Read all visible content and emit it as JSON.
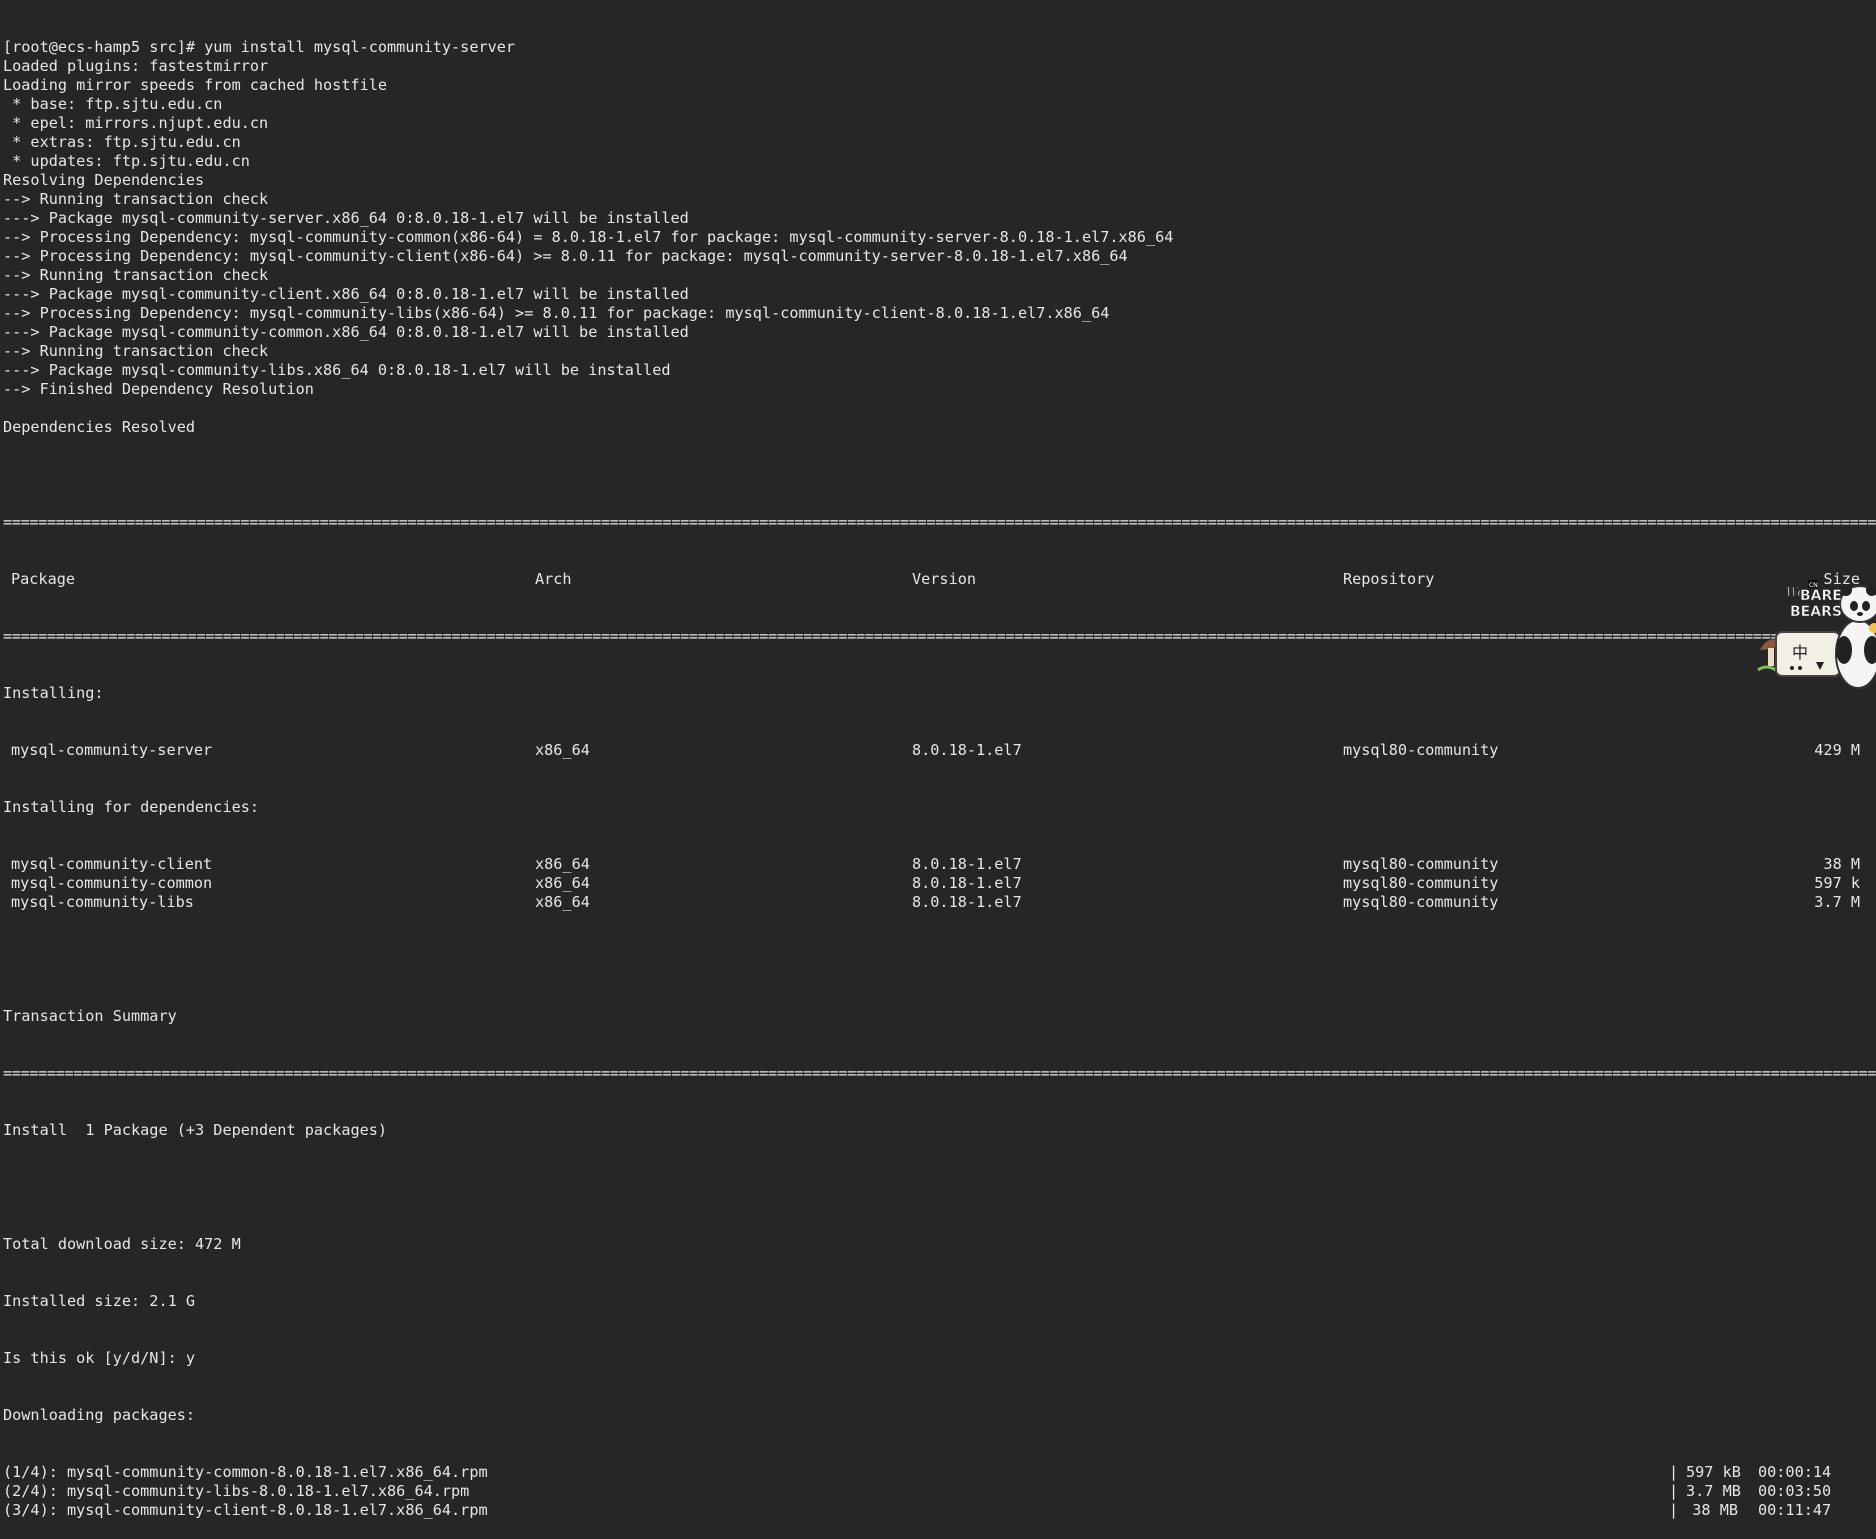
{
  "header_lines": [
    "[root@ecs-hamp5 src]# yum install mysql-community-server",
    "Loaded plugins: fastestmirror",
    "Loading mirror speeds from cached hostfile",
    " * base: ftp.sjtu.edu.cn",
    " * epel: mirrors.njupt.edu.cn",
    " * extras: ftp.sjtu.edu.cn",
    " * updates: ftp.sjtu.edu.cn",
    "Resolving Dependencies",
    "--> Running transaction check",
    "---> Package mysql-community-server.x86_64 0:8.0.18-1.el7 will be installed",
    "--> Processing Dependency: mysql-community-common(x86-64) = 8.0.18-1.el7 for package: mysql-community-server-8.0.18-1.el7.x86_64",
    "--> Processing Dependency: mysql-community-client(x86-64) >= 8.0.11 for package: mysql-community-server-8.0.18-1.el7.x86_64",
    "--> Running transaction check",
    "---> Package mysql-community-client.x86_64 0:8.0.18-1.el7 will be installed",
    "--> Processing Dependency: mysql-community-libs(x86-64) >= 8.0.11 for package: mysql-community-client-8.0.18-1.el7.x86_64",
    "---> Package mysql-community-common.x86_64 0:8.0.18-1.el7 will be installed",
    "--> Running transaction check",
    "---> Package mysql-community-libs.x86_64 0:8.0.18-1.el7 will be installed",
    "--> Finished Dependency Resolution",
    "",
    "Dependencies Resolved",
    ""
  ],
  "table": {
    "separator": "================================================================================================================================================================================================================================================================",
    "columns": {
      "package": "Package",
      "arch": "Arch",
      "version": "Version",
      "repository": "Repository",
      "size": "Size"
    },
    "installing_label": "Installing:",
    "installing_rows": [
      {
        "package": "mysql-community-server",
        "arch": "x86_64",
        "version": "8.0.18-1.el7",
        "repository": "mysql80-community",
        "size": "429 M"
      }
    ],
    "deps_label": "Installing for dependencies:",
    "dep_rows": [
      {
        "package": "mysql-community-client",
        "arch": "x86_64",
        "version": "8.0.18-1.el7",
        "repository": "mysql80-community",
        "size": "38 M"
      },
      {
        "package": "mysql-community-common",
        "arch": "x86_64",
        "version": "8.0.18-1.el7",
        "repository": "mysql80-community",
        "size": "597 k"
      },
      {
        "package": "mysql-community-libs",
        "arch": "x86_64",
        "version": "8.0.18-1.el7",
        "repository": "mysql80-community",
        "size": "3.7 M"
      }
    ]
  },
  "summary": {
    "title": "Transaction Summary",
    "install_line": "Install  1 Package (+3 Dependent packages)",
    "download_size": "Total download size: 472 M",
    "installed_size": "Installed size: 2.1 G",
    "prompt": "Is this ok [y/d/N]: y",
    "downloading": "Downloading packages:"
  },
  "downloads": [
    {
      "name": "(1/4): mysql-community-common-8.0.18-1.el7.x86_64.rpm",
      "size": "597 kB",
      "time": "00:00:14"
    },
    {
      "name": "(2/4): mysql-community-libs-8.0.18-1.el7.x86_64.rpm",
      "size": "3.7 MB",
      "time": "00:03:50"
    },
    {
      "name": "(3/4): mysql-community-client-8.0.18-1.el7.x86_64.rpm",
      "size": "38 MB",
      "time": "00:11:47"
    }
  ],
  "download_bar": "|",
  "mascot": {
    "icon": "bare-bears-panda-icon",
    "logo_small": "CN",
    "logo_line1": "We",
    "logo_line2": "BARE",
    "logo_line3": "BEARS",
    "glyph": "中"
  },
  "colors": {
    "background": "#262626",
    "foreground": "#e6e6e6"
  }
}
